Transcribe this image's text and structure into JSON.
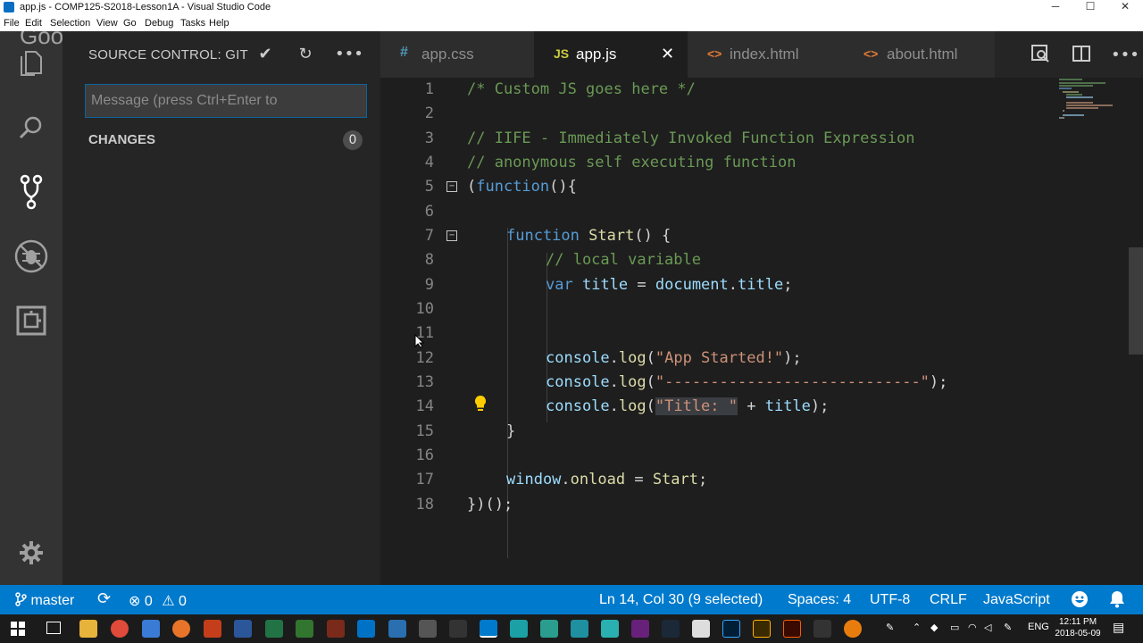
{
  "window": {
    "title": "app.js - COMP125-S2018-Lesson1A - Visual Studio Code",
    "controls": [
      "─",
      "☐",
      "✕"
    ]
  },
  "menu": [
    "File",
    "Edit",
    "Selection",
    "View",
    "Go",
    "Debug",
    "Tasks",
    "Help"
  ],
  "watermark": "Google",
  "activity_bar": {
    "items": [
      "explorer-icon",
      "search-icon",
      "source-control-icon",
      "debug-icon",
      "extensions-icon"
    ],
    "active": "source-control-icon",
    "bottom": "gear-icon"
  },
  "sidebar": {
    "title": "SOURCE CONTROL: GIT",
    "commit_placeholder": "Message (press Ctrl+Enter to",
    "changes_label": "CHANGES",
    "changes_count": "0",
    "header_icons": [
      "checkmark-icon",
      "refresh-icon",
      "more-icon"
    ]
  },
  "tabs": [
    {
      "icon": "#",
      "label": "app.css",
      "active": false
    },
    {
      "icon": "JS",
      "label": "app.js",
      "active": true,
      "close": "✕"
    },
    {
      "icon": "<>",
      "label": "index.html",
      "active": false
    },
    {
      "icon": "<>",
      "label": "about.html",
      "active": false
    }
  ],
  "editor_actions": [
    "open-changes-icon",
    "split-editor-icon",
    "more-icon"
  ],
  "editor": {
    "line_numbers": [
      "1",
      "2",
      "3",
      "4",
      "5",
      "6",
      "7",
      "8",
      "9",
      "10",
      "11",
      "12",
      "13",
      "14",
      "15",
      "16",
      "17",
      "18"
    ],
    "lines": {
      "l1": "/* Custom JS goes here */",
      "l3": "// IIFE - Immediately Invoked Function Expression",
      "l4": "// anonymous self executing function",
      "l5_open": "(",
      "l5_kw": "function",
      "l5_rest": "(){",
      "l7_kw": "function",
      "l7_fn": "Start",
      "l7_rest": "() {",
      "l8": "// local variable",
      "l9_kw": "var",
      "l9_var": "title",
      "l9_eq": " = ",
      "l9_obj": "document",
      "l9_dot": ".",
      "l9_prop": "title",
      "l9_end": ";",
      "l12_obj": "console",
      "l12_dot": ".",
      "l12_fn": "log",
      "l12_open": "(",
      "l12_str": "\"App Started!\"",
      "l12_end": ");",
      "l13_obj": "console",
      "l13_dot": ".",
      "l13_fn": "log",
      "l13_open": "(",
      "l13_str": "\"----------------------------\"",
      "l13_end": ");",
      "l14_obj": "console",
      "l14_dot": ".",
      "l14_fn": "log",
      "l14_open": "(",
      "l14_str": "\"Title: \"",
      "l14_plus": " + ",
      "l14_var": "title",
      "l14_end": ");",
      "l15": "}",
      "l17_obj": "window",
      "l17_dot": ".",
      "l17_prop": "onload",
      "l17_eq": " = ",
      "l17_fn": "Start",
      "l17_end": ";",
      "l18": "})();"
    }
  },
  "status_bar": {
    "branch": "master",
    "errors": "0",
    "warnings": "0",
    "cursor": "Ln 14, Col 30 (9 selected)",
    "spaces": "Spaces: 4",
    "encoding": "UTF-8",
    "eol": "CRLF",
    "language": "JavaScript"
  },
  "taskbar": {
    "lang": "ENG",
    "time": "12:11 PM",
    "date": "2018-05-09"
  },
  "colors": {
    "accent": "#007acc",
    "comment": "#6a9955",
    "keyword": "#569cd6",
    "function": "#dcdcaa",
    "string": "#ce9178",
    "variable": "#9cdcfe"
  }
}
